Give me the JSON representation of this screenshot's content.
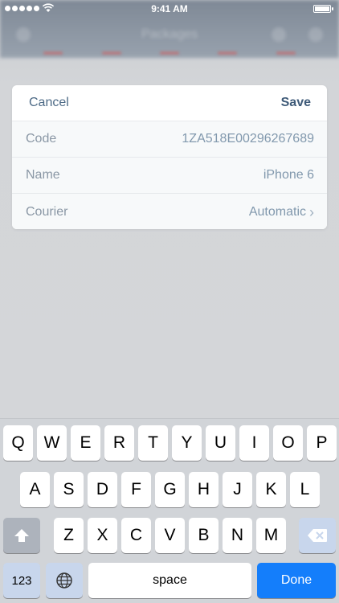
{
  "status_bar": {
    "time": "9:41 AM",
    "signal_dots": 5
  },
  "background_app": {
    "title": "Packages"
  },
  "dialog": {
    "cancel_label": "Cancel",
    "save_label": "Save",
    "fields": [
      {
        "label": "Code",
        "value": "1ZA518E00296267689"
      },
      {
        "label": "Name",
        "value": "iPhone 6"
      },
      {
        "label": "Courier",
        "value": "Automatic"
      }
    ]
  },
  "keyboard": {
    "row1": [
      "Q",
      "W",
      "E",
      "R",
      "T",
      "Y",
      "U",
      "I",
      "O",
      "P"
    ],
    "row2": [
      "A",
      "S",
      "D",
      "F",
      "G",
      "H",
      "J",
      "K",
      "L"
    ],
    "row3": [
      "Z",
      "X",
      "C",
      "V",
      "B",
      "N",
      "M"
    ],
    "numbers_label": "123",
    "space_label": "space",
    "done_label": "Done"
  },
  "colors": {
    "accent_blue": "#147efb",
    "link_text": "#4d6a86"
  }
}
